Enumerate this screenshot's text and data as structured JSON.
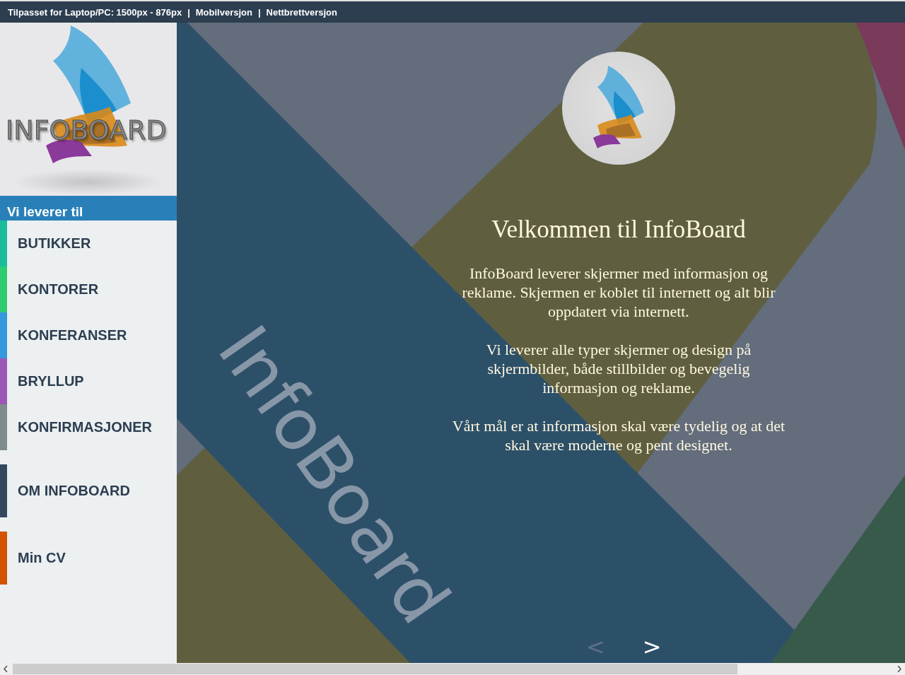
{
  "top_bar": {
    "info": "Tilpasset for Laptop/PC: 1500px - 876px",
    "links": [
      {
        "label": "Mobilversjon"
      },
      {
        "label": "Nettbrettversjon"
      }
    ],
    "separator": "|"
  },
  "sidebar": {
    "logo_text": "INFOBOARD",
    "heading": "Vi leverer til",
    "items": [
      {
        "label": "BUTIKKER",
        "color": "#1abc9c"
      },
      {
        "label": "KONTORER",
        "color": "#2ecc71"
      },
      {
        "label": "KONFERANSER",
        "color": "#3498db"
      },
      {
        "label": "BRYLLUP",
        "color": "#9b59b6"
      },
      {
        "label": "KONFIRMASJONER",
        "color": "#7f8c8d"
      }
    ],
    "extra_items": [
      {
        "label": "OM INFOBOARD",
        "color": "#34495e"
      },
      {
        "label": "Min CV",
        "color": "#d35400"
      }
    ]
  },
  "slide": {
    "background_text": "InfoBoard",
    "title": "Velkommen til InfoBoard",
    "paragraphs": [
      "InfoBoard leverer skjermer med informasjon og reklame. Skjermen er koblet til internett og alt blir oppdatert via internett.",
      "Vi leverer alle typer skjermer og design på skjermbilder, både stillbilder og bevegelig informasjon og reklame.",
      "Vårt mål er at informasjon skal være tydelig og at det skal være moderne og pent designet."
    ],
    "prev": {
      "glyph": "<",
      "disabled": true
    },
    "next": {
      "glyph": ">",
      "disabled": false
    }
  }
}
